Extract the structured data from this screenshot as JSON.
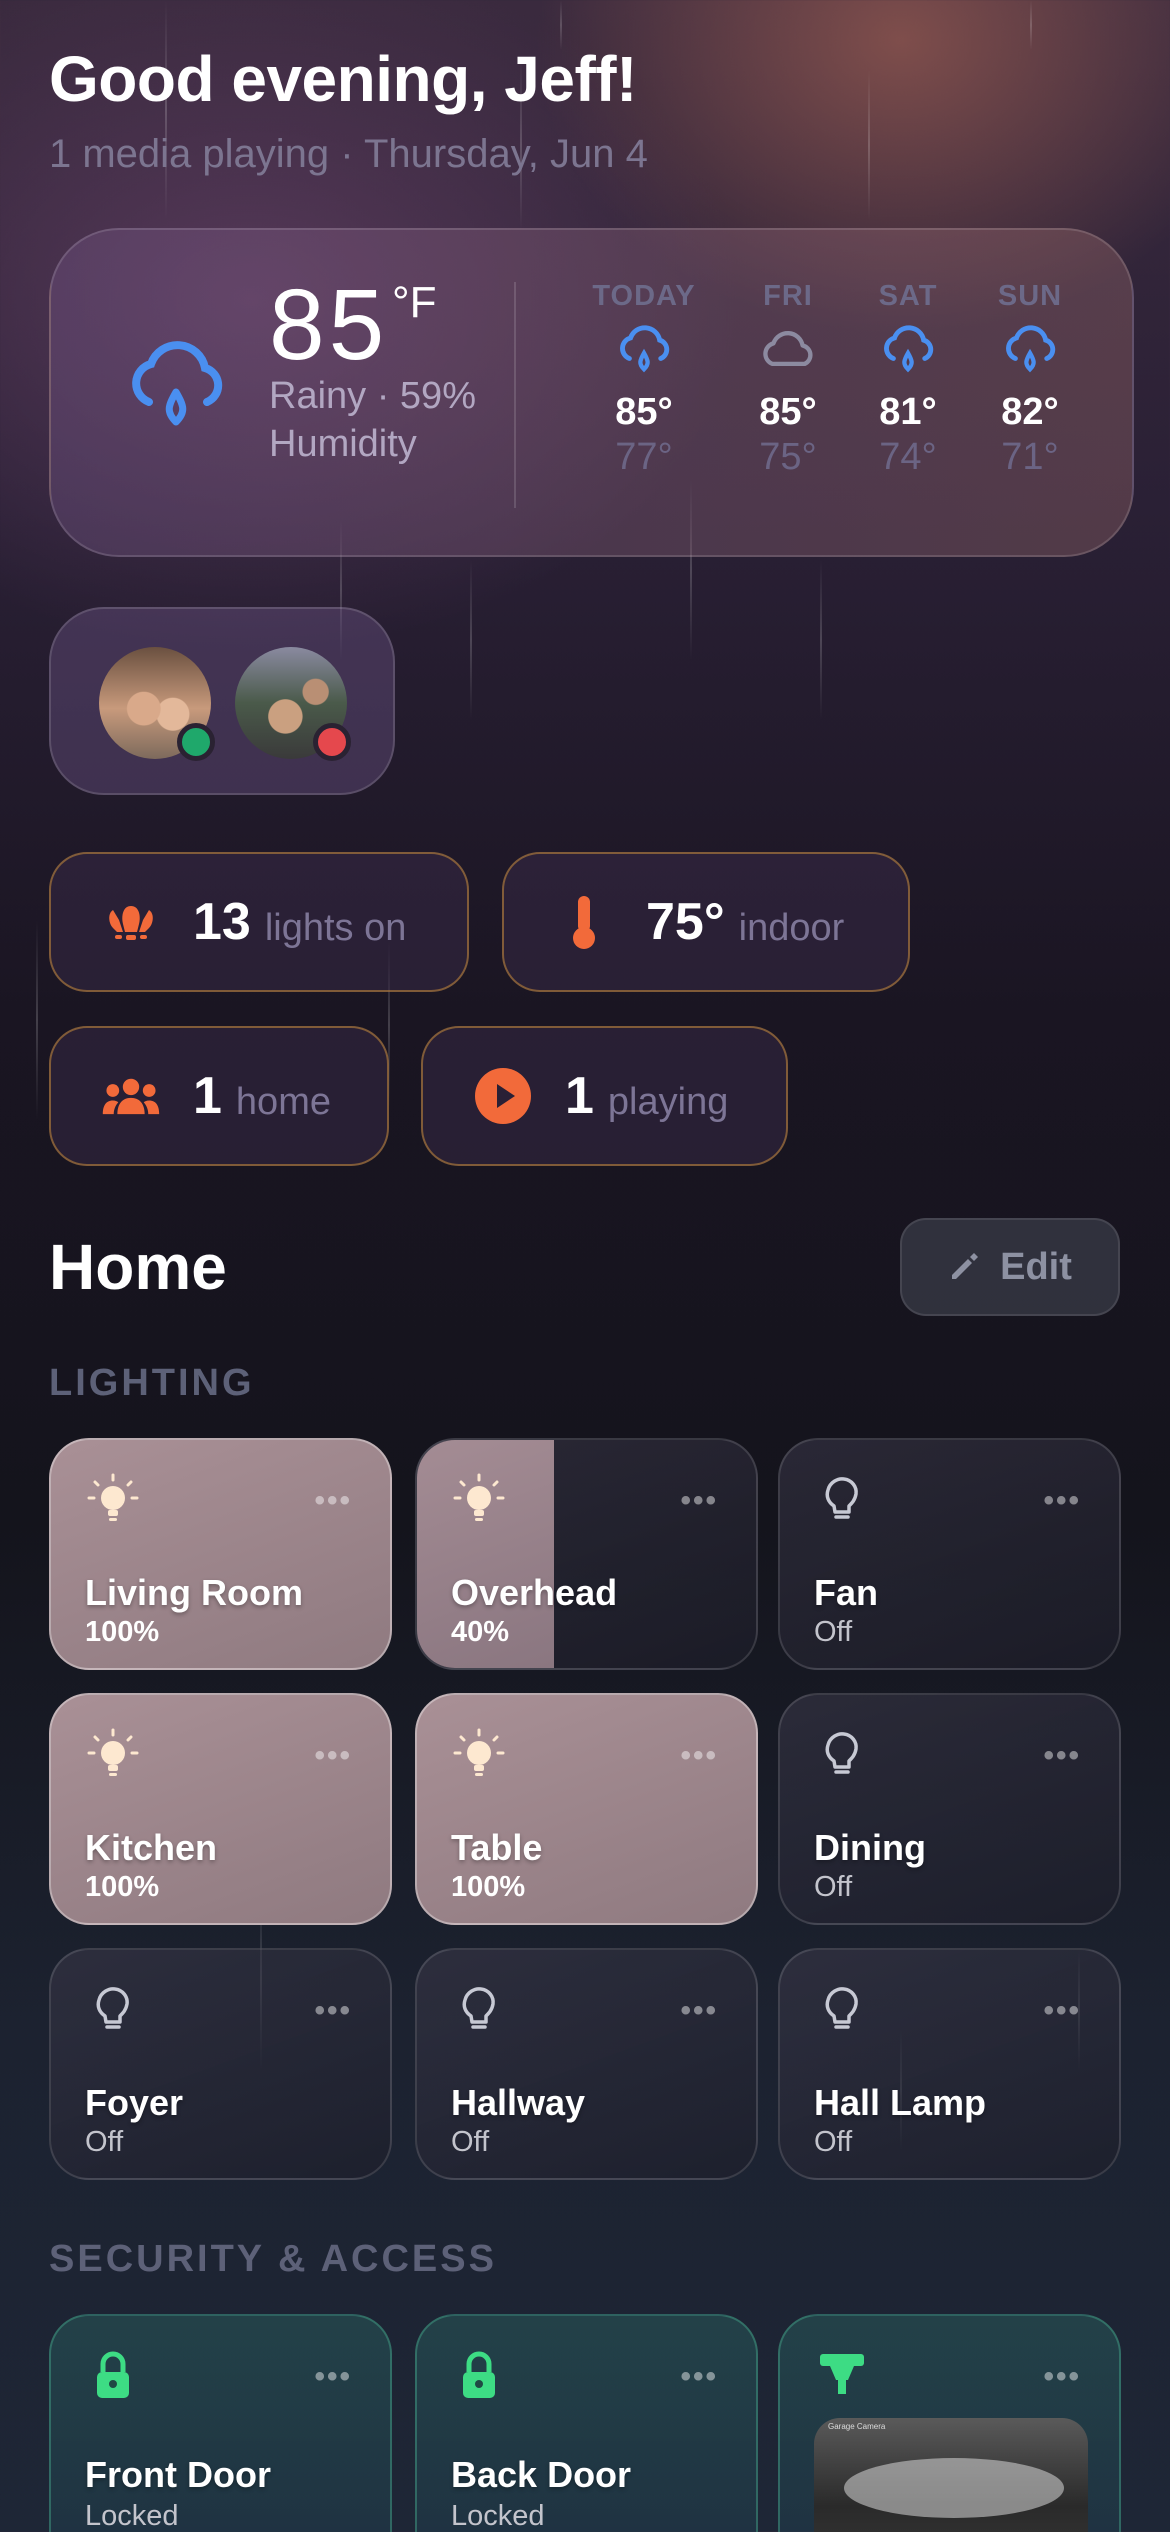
{
  "header": {
    "greeting": "Good evening, Jeff!",
    "subtitle": "1 media playing · Thursday, Jun 4"
  },
  "weather": {
    "icon": "rain-cloud-icon",
    "temperature": "85",
    "unit": "°F",
    "condition": "Rainy · 59% Humidity",
    "forecast": [
      {
        "day": "TODAY",
        "icon": "rain-cloud-icon",
        "high": "85°",
        "low": "77°"
      },
      {
        "day": "FRI",
        "icon": "cloud-icon",
        "high": "85°",
        "low": "75°"
      },
      {
        "day": "SAT",
        "icon": "rain-cloud-icon",
        "high": "81°",
        "low": "74°"
      },
      {
        "day": "SUN",
        "icon": "rain-cloud-icon",
        "high": "82°",
        "low": "71°"
      }
    ]
  },
  "people": [
    {
      "status": "home",
      "status_color": "#1fa86b"
    },
    {
      "status": "away",
      "status_color": "#e5484d"
    }
  ],
  "stats": {
    "lights": {
      "value": "13",
      "label": "lights on",
      "icon": "light-group-icon"
    },
    "indoor": {
      "value": "75°",
      "label": "indoor",
      "icon": "thermometer-icon"
    },
    "home": {
      "value": "1",
      "label": "home",
      "icon": "people-icon"
    },
    "playing": {
      "value": "1",
      "label": "playing",
      "icon": "play-icon"
    }
  },
  "home": {
    "title": "Home",
    "edit_label": "Edit"
  },
  "sections": {
    "lighting": "LIGHTING",
    "security": "SECURITY & ACCESS"
  },
  "lights": [
    {
      "name": "Living Room",
      "state": "100%",
      "level": 1.0
    },
    {
      "name": "Overhead",
      "state": "40%",
      "level": 0.4
    },
    {
      "name": "Fan",
      "state": "Off",
      "level": 0
    },
    {
      "name": "Kitchen",
      "state": "100%",
      "level": 1.0
    },
    {
      "name": "Table",
      "state": "100%",
      "level": 1.0
    },
    {
      "name": "Dining",
      "state": "Off",
      "level": 0
    },
    {
      "name": "Foyer",
      "state": "Off",
      "level": 0
    },
    {
      "name": "Hallway",
      "state": "Off",
      "level": 0
    },
    {
      "name": "Hall Lamp",
      "state": "Off",
      "level": 0
    }
  ],
  "security": [
    {
      "name": "Front Door",
      "state": "Locked",
      "icon": "lock-icon"
    },
    {
      "name": "Back Door",
      "state": "Locked",
      "icon": "lock-icon"
    },
    {
      "name": "Garage Camera",
      "icon": "camera-icon"
    }
  ],
  "colors": {
    "accent": "#f26a3a",
    "weather_blue": "#4a8ff0",
    "lock_green": "#3ddc84"
  }
}
